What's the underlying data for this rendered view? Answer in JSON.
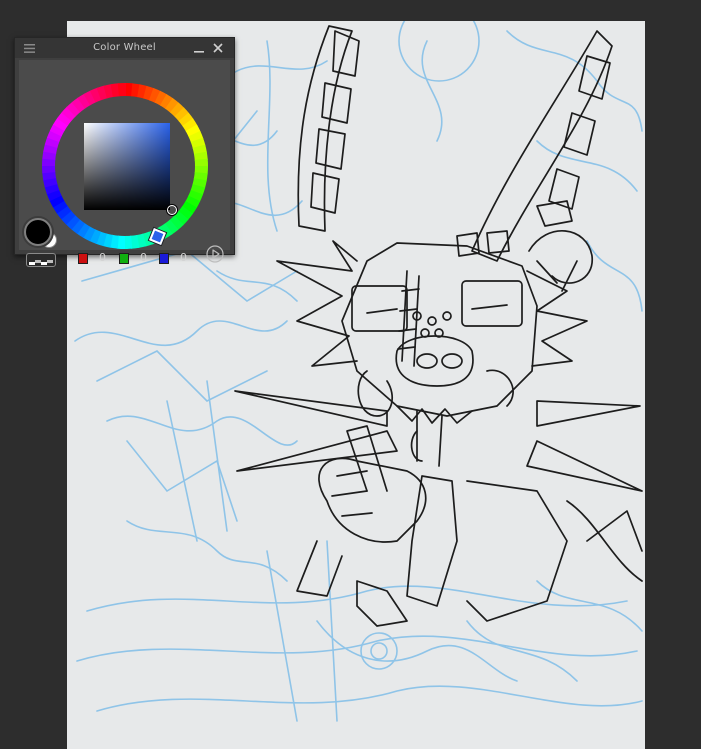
{
  "color_wheel_panel": {
    "title": "Color Wheel",
    "main_color": "#000000",
    "sub_color": "#ffffff",
    "hue_color": "#2a62ea",
    "rgb": {
      "r": "0",
      "g": "0",
      "b": "0"
    },
    "controls": {
      "grip_icon": "menu-grip-icon",
      "minimize_icon": "minimize-icon",
      "close_icon": "close-icon",
      "mode_icon": "color-mode-switch-icon",
      "next_icon": "play-arrow-icon"
    }
  },
  "canvas": {
    "paper_color": "#e7e9ea",
    "sketch_color": "#8fc4e8",
    "ink_color": "#1d1d1d"
  }
}
